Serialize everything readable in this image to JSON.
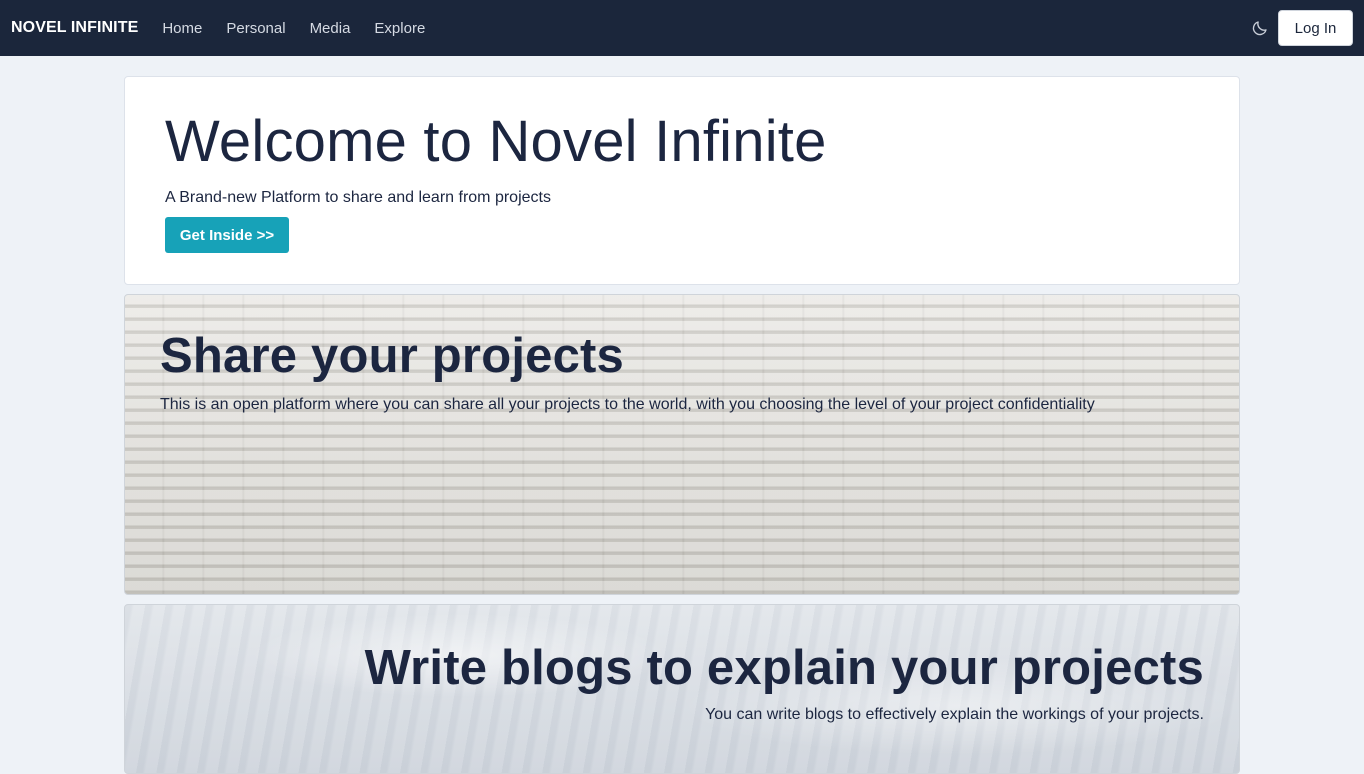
{
  "navbar": {
    "brand": "NOVEL INFINITE",
    "links": [
      "Home",
      "Personal",
      "Media",
      "Explore"
    ],
    "theme_toggle_icon": "moon-icon",
    "login_label": "Log In"
  },
  "hero": {
    "title": "Welcome to Novel Infinite",
    "subtitle": "A Brand-new Platform to share and learn from projects",
    "cta_label": "Get Inside >>"
  },
  "features": [
    {
      "title": "Share your projects",
      "text": "This is an open platform where you can share all your projects to the world, with you choosing the level of your project confidentiality"
    },
    {
      "title": "Write blogs to explain your projects",
      "text": "You can write blogs to effectively explain the workings of your projects."
    }
  ],
  "colors": {
    "navbar_bg": "#1b263b",
    "page_bg": "#eef2f7",
    "accent": "#17a2b8",
    "text_dark": "#1c2640"
  }
}
